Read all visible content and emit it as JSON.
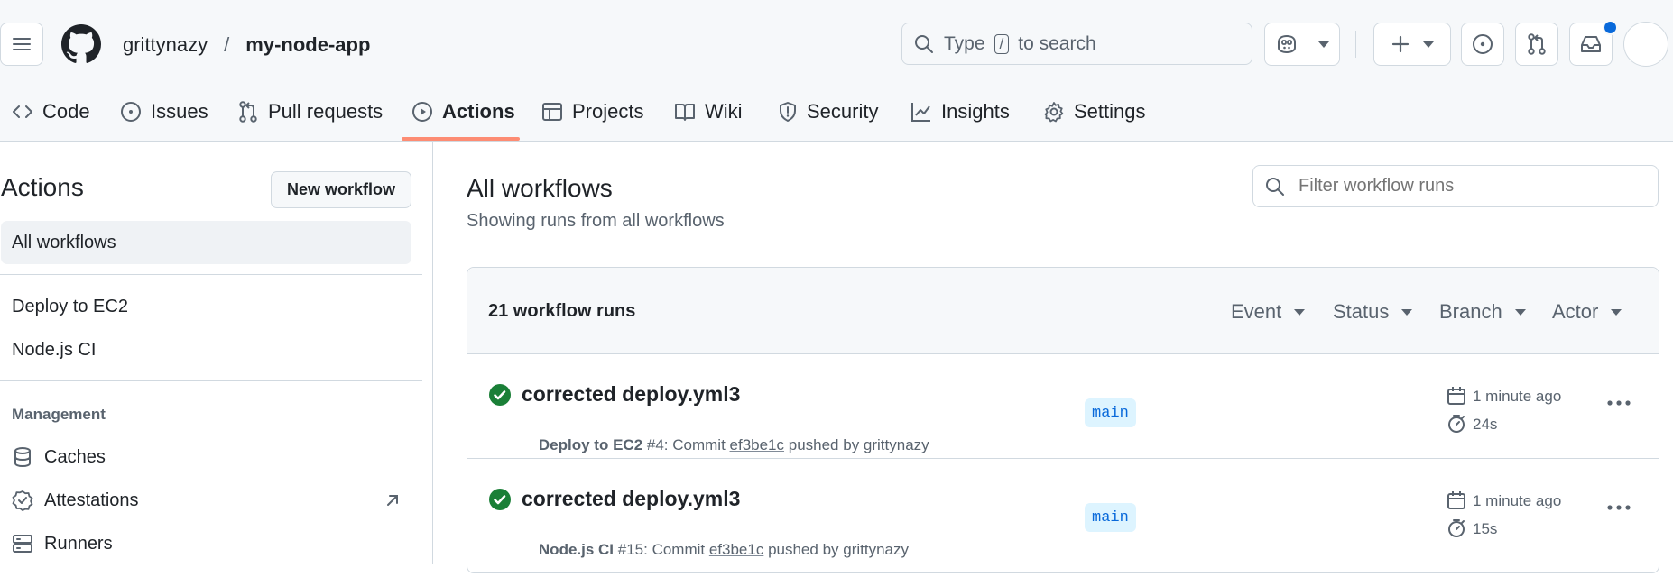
{
  "header": {
    "owner": "grittynazy",
    "separator": "/",
    "repo": "my-node-app",
    "search": {
      "pre": "Type",
      "key": "/",
      "post": "to search"
    }
  },
  "tabs": [
    {
      "label": "Code",
      "icon": "code-icon"
    },
    {
      "label": "Issues",
      "icon": "issue-icon"
    },
    {
      "label": "Pull requests",
      "icon": "pull-request-icon"
    },
    {
      "label": "Actions",
      "icon": "play-icon",
      "selected": true
    },
    {
      "label": "Projects",
      "icon": "table-icon"
    },
    {
      "label": "Wiki",
      "icon": "book-icon"
    },
    {
      "label": "Security",
      "icon": "shield-icon"
    },
    {
      "label": "Insights",
      "icon": "graph-icon"
    },
    {
      "label": "Settings",
      "icon": "gear-icon"
    }
  ],
  "sidebar": {
    "title": "Actions",
    "new_workflow": "New workflow",
    "all_workflows": "All workflows",
    "workflows": [
      "Deploy to EC2",
      "Node.js CI"
    ],
    "management_heading": "Management",
    "management": [
      {
        "label": "Caches",
        "icon": "database-icon"
      },
      {
        "label": "Attestations",
        "icon": "verified-icon"
      },
      {
        "label": "Runners",
        "icon": "server-icon"
      }
    ]
  },
  "main": {
    "title": "All workflows",
    "subtitle": "Showing runs from all workflows",
    "filter_placeholder": "Filter workflow runs",
    "runs_count": "21 workflow runs",
    "filters": [
      "Event",
      "Status",
      "Branch",
      "Actor"
    ]
  },
  "runs": [
    {
      "title": "corrected deploy.yml3",
      "workflow": "Deploy to EC2",
      "number": " #4: Commit ",
      "commit": "ef3be1c",
      "pushed": " pushed by grittynazy",
      "branch": "main",
      "time": "1 minute ago",
      "duration": "24s",
      "status": "success"
    },
    {
      "title": "corrected deploy.yml3",
      "workflow": "Node.js CI",
      "number": " #15: Commit ",
      "commit": "ef3be1c",
      "pushed": " pushed by grittynazy",
      "branch": "main",
      "time": "1 minute ago",
      "duration": "15s",
      "status": "success"
    }
  ],
  "colors": {
    "accent": "#fd8c73",
    "success": "#1a7f37",
    "link": "#0969da",
    "notification": "#0969da"
  }
}
